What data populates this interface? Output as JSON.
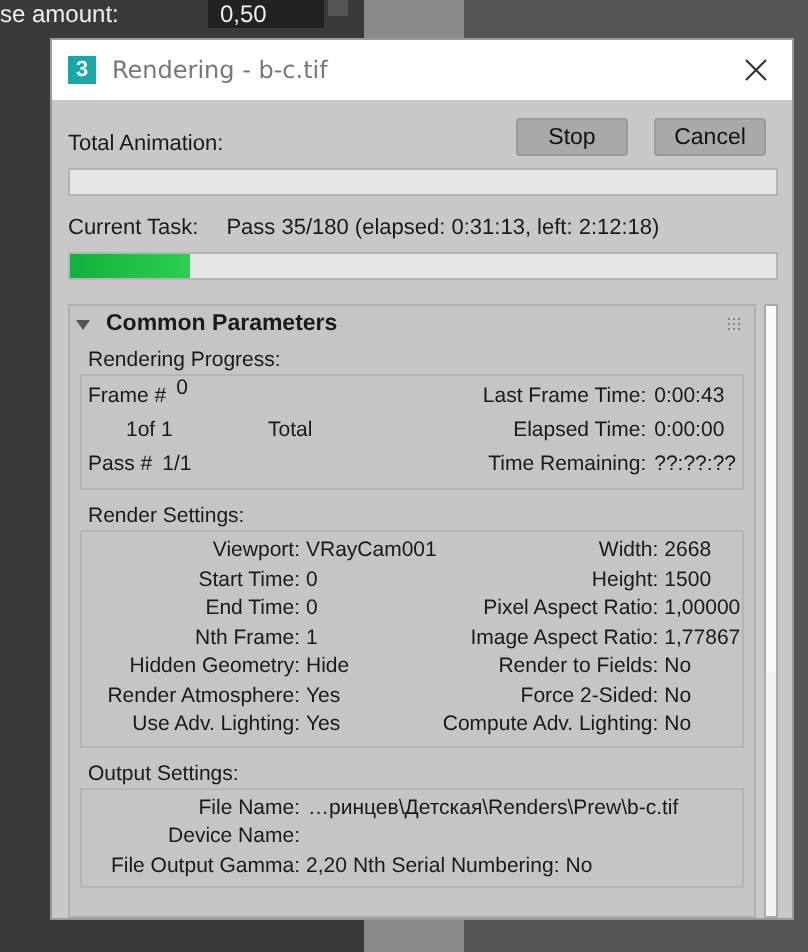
{
  "background": {
    "label": "se amount:",
    "field_value": "0,50"
  },
  "window": {
    "title": "Rendering - b-c.tif",
    "app_icon": "3"
  },
  "buttons": [
    "Stop",
    "Cancel"
  ],
  "total_animation": {
    "label": "Total Animation:"
  },
  "current_task": {
    "label": "Current Task:",
    "text": "Pass 35/180 (elapsed: 0:31:13, left: 2:12:18)",
    "level": 0.17
  },
  "rollout": {
    "title": "Common Parameters",
    "expanded": true,
    "rendering_progress": {
      "title": "Rendering Progress:",
      "frame_label": "Frame #",
      "frame": "0",
      "count": "1of 1",
      "total": "Total",
      "pass_label": "Pass #",
      "pass": "1/1",
      "times": [
        {
          "label": "Last Frame Time:",
          "value": "0:00:43"
        },
        {
          "label": "Elapsed Time:",
          "value": "0:00:00"
        },
        {
          "label": "Time Remaining:",
          "value": "??:??:??"
        }
      ]
    },
    "render_settings": {
      "title": "Render Settings:",
      "rows": [
        {
          "label": "Viewport:",
          "value": "VRayCam001",
          "label_2": "Width:",
          "value_2": "2668"
        },
        {
          "label": "Start Time:",
          "value": "0",
          "label_2": "Height:",
          "value_2": "1500"
        },
        {
          "label": "End Time:",
          "value": "0",
          "label_2": "Pixel Aspect Ratio:",
          "value_2": "1,00000"
        },
        {
          "label": "Nth Frame:",
          "value": "1",
          "label_2": "Image Aspect Ratio:",
          "value_2": "1,77867"
        },
        {
          "label": "Hidden Geometry:",
          "value": "Hide",
          "label_2": "Render to Fields:",
          "value_2": "No"
        },
        {
          "label": "Render Atmosphere:",
          "value": "Yes",
          "label_2": "Force 2-Sided:",
          "value_2": "No"
        },
        {
          "label": "Use Adv. Lighting:",
          "value": "Yes",
          "label_2": "Compute Adv. Lighting:",
          "value_2": "No"
        }
      ]
    },
    "output_settings": {
      "title": "Output Settings:",
      "file_name": {
        "label": "File Name:",
        "value": "…ринцев\\Детская\\Renders\\Prew\\b-c.tif"
      },
      "device_name": {
        "label": "Device Name:"
      },
      "rows": [
        {
          "label": "File Output Gamma:",
          "value": "2,20",
          "label_2": "Nth Serial Numbering:",
          "value_2": "No"
        }
      ]
    }
  }
}
